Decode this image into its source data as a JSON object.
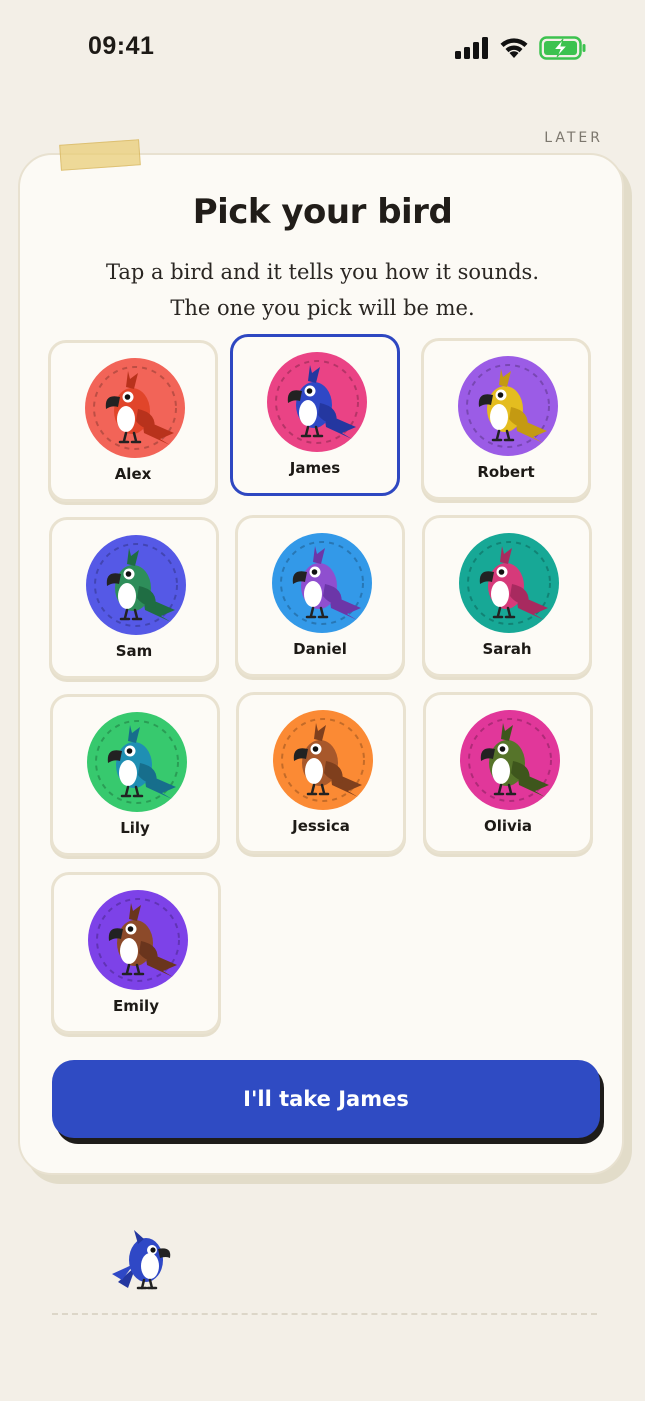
{
  "status": {
    "time": "09:41"
  },
  "later_label": "LATER",
  "title": "Pick your bird",
  "subtitle": "Tap a bird and it tells you how it sounds. The one you pick will be me.",
  "selected": "James",
  "birds": [
    {
      "name": "Alex",
      "bg": "#f26458",
      "body": "#e1452a",
      "wing": "#b8321c"
    },
    {
      "name": "James",
      "bg": "#ea4385",
      "body": "#2f48c6",
      "wing": "#2437a0"
    },
    {
      "name": "Robert",
      "bg": "#9b5ce6",
      "body": "#e4bd1f",
      "wing": "#c49a12"
    },
    {
      "name": "Sam",
      "bg": "#5559e6",
      "body": "#2e8e5a",
      "wing": "#1f6d43"
    },
    {
      "name": "Daniel",
      "bg": "#3399e8",
      "body": "#8f4fcf",
      "wing": "#6c36a8"
    },
    {
      "name": "Sarah",
      "bg": "#17a896",
      "body": "#d63a7a",
      "wing": "#a82a5f"
    },
    {
      "name": "Lily",
      "bg": "#37c96e",
      "body": "#1f8fb3",
      "wing": "#176e8c"
    },
    {
      "name": "Jessica",
      "bg": "#fb8a34",
      "body": "#a8582b",
      "wing": "#7f3f1d"
    },
    {
      "name": "Olivia",
      "bg": "#e1379a",
      "body": "#56742a",
      "wing": "#3e561c"
    },
    {
      "name": "Emily",
      "bg": "#7d42e8",
      "body": "#8c4a2a",
      "wing": "#6a351d"
    }
  ],
  "cta_label": "I'll take James",
  "colors": {
    "accent": "#2f4bc3",
    "background": "#f3efe7",
    "card": "#fcfaf5"
  },
  "icons": [
    "signal-icon",
    "wifi-icon",
    "battery-charging-icon"
  ]
}
